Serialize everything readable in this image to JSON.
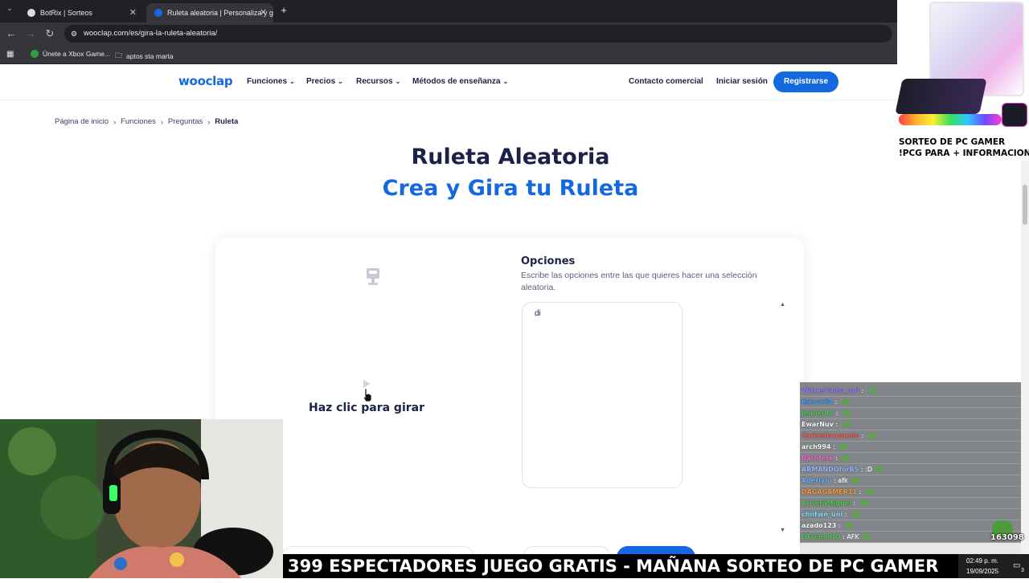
{
  "browser": {
    "tabs": [
      {
        "title": "BotRix | Sorteos",
        "active": false
      },
      {
        "title": "Ruleta aleatoria | Personaliza y g",
        "active": true
      }
    ],
    "new_tab_symbol": "+",
    "url": "wooclap.com/es/gira-la-ruleta-aleatoria/",
    "bookmarks": [
      {
        "label": "Únete a Xbox Game...",
        "icon": "xbox-icon"
      },
      {
        "label": "aptos sta marta",
        "icon": "folder-icon"
      }
    ]
  },
  "site": {
    "logo": "wooclap",
    "menu": [
      "Funciones",
      "Precios",
      "Recursos",
      "Métodos de enseñanza"
    ],
    "contact": "Contacto comercial",
    "login": "Iniciar sesión",
    "register": "Registrarse",
    "brand_color": "#1469e1",
    "text_color": "#1b2147"
  },
  "breadcrumb": [
    "Página de inicio",
    "Funciones",
    "Preguntas",
    "Ruleta"
  ],
  "hero": {
    "title": "Ruleta Aleatoria",
    "subtitle": "Crea y Gira tu Ruleta"
  },
  "wheel": {
    "spin_label": "Haz clic para girar"
  },
  "options": {
    "title": "Opciones",
    "description": "Escribe las opciones entre las que quieres hacer una selección aleatoria.",
    "value": "di"
  },
  "overlay": {
    "ad_text_line1": "SORTEO DE PC GAMER",
    "ad_text_line2": "!PCG PARA + INFORMACION",
    "chat": [
      {
        "user": "WitherGoba_uni",
        "msg": "",
        "color": "#9b7bff"
      },
      {
        "user": "Kanvo64",
        "msg": "",
        "color": "#3ea0ff"
      },
      {
        "user": "Jeuneuto",
        "msg": "",
        "color": "#4fd04f"
      },
      {
        "user": "EwarNuv",
        "msg": "",
        "color": "#ffffff"
      },
      {
        "user": "Carloshanzando",
        "msg": "",
        "color": "#ff5b5b"
      },
      {
        "user": "arch994",
        "msg": "",
        "color": "#ffffff"
      },
      {
        "user": "Barhterk",
        "msg": "",
        "color": "#ff6bd1"
      },
      {
        "user": "ARMANDOforBS",
        "msg": ":D",
        "color": "#9bb7ff"
      },
      {
        "user": "Aderlyjo",
        "msg": "afk",
        "color": "#6bb0ff"
      },
      {
        "user": "DAGAGAMER11",
        "msg": "",
        "color": "#ff9a2e"
      },
      {
        "user": "ArrieraMiguel",
        "msg": "",
        "color": "#4fd04f"
      },
      {
        "user": "chntwn_uni",
        "msg": "",
        "color": "#7fe0ff"
      },
      {
        "user": "azado123",
        "msg": "",
        "color": "#ffffff"
      },
      {
        "user": "OFremoOO",
        "msg": "AFK",
        "color": "#4fd04f"
      }
    ],
    "viewer_counter": "163098",
    "ticker": "399 ESPECTADORES JUEGO GRATIS - MAÑANA SORTEO DE PC GAMER",
    "clock_time": "02:49 p. m.",
    "clock_date": "19/09/2025",
    "notification_count": "3"
  }
}
